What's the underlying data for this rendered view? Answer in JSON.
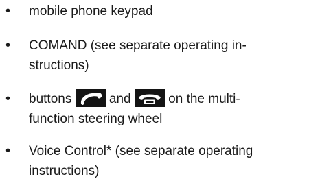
{
  "list": {
    "items": [
      {
        "bullet": "•",
        "lines": [
          "mobile phone keypad"
        ]
      },
      {
        "bullet": "•",
        "lines": [
          "COMAND (see separate operating in-",
          "structions)"
        ]
      },
      {
        "bullet": "•",
        "parts": [
          "buttons",
          "and",
          "on the multi-"
        ],
        "line2": "function steering wheel",
        "icons": [
          "phone-accept-icon",
          "phone-hangup-icon"
        ]
      },
      {
        "bullet": "•",
        "lines": [
          "Voice Control* (see separate operating",
          "instructions)"
        ]
      }
    ]
  }
}
